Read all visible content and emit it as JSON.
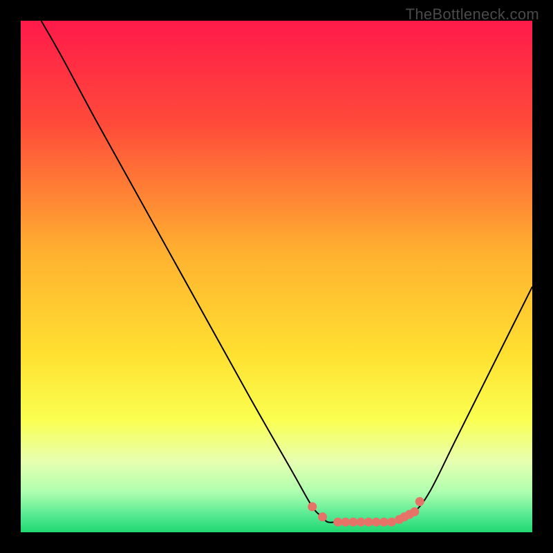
{
  "watermark": "TheBottleneck.com",
  "chart_data": {
    "type": "line",
    "title": "",
    "xlabel": "",
    "ylabel": "",
    "xlim": [
      0,
      100
    ],
    "ylim": [
      0,
      100
    ],
    "series": [
      {
        "name": "bottleneck-curve",
        "x": [
          4,
          8,
          15,
          25,
          35,
          45,
          53,
          57,
          59,
          60,
          62,
          65,
          68,
          72,
          75,
          77,
          80,
          85,
          90,
          95,
          100
        ],
        "y": [
          100,
          93,
          80,
          62,
          44,
          26,
          12,
          5,
          3,
          2,
          2,
          2,
          2,
          2,
          3,
          4,
          8,
          18,
          28,
          38,
          48
        ],
        "color": "#000000"
      }
    ],
    "markers": {
      "name": "highlight-dots",
      "x": [
        57,
        59,
        62,
        63.5,
        65,
        66.5,
        68,
        69.5,
        71,
        72.5,
        74,
        75,
        76,
        77,
        78
      ],
      "y": [
        5,
        3,
        2,
        2,
        2,
        2,
        2,
        2,
        2,
        2,
        2.5,
        3,
        3.5,
        4,
        6
      ],
      "color": "#e57368"
    },
    "gradient_stops": [
      {
        "offset": 0,
        "color": "#ff1a4a"
      },
      {
        "offset": 20,
        "color": "#ff4a3a"
      },
      {
        "offset": 45,
        "color": "#ffb030"
      },
      {
        "offset": 65,
        "color": "#ffe030"
      },
      {
        "offset": 78,
        "color": "#faff50"
      },
      {
        "offset": 86,
        "color": "#e8ffb0"
      },
      {
        "offset": 92,
        "color": "#b0ffb0"
      },
      {
        "offset": 97,
        "color": "#50e890"
      },
      {
        "offset": 100,
        "color": "#20d870"
      }
    ]
  }
}
